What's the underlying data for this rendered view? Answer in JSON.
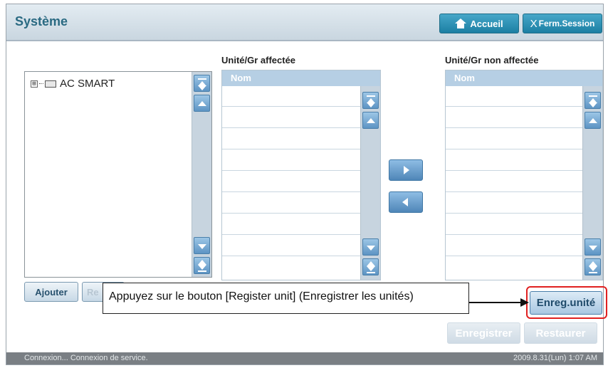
{
  "header": {
    "title": "Système",
    "home_label": "Accueil",
    "logout_x": "X",
    "logout_label": "Ferm.Session"
  },
  "tree": {
    "expander": "⊞",
    "root_label": "AC SMART"
  },
  "assigned": {
    "title": "Unité/Gr affectée",
    "column": "Nom"
  },
  "unassigned": {
    "title": "Unité/Gr non affectée",
    "column": "Nom"
  },
  "buttons": {
    "add": "Ajouter",
    "partial": "Re",
    "register_unit": "Enreg.unité",
    "save": "Enregistrer",
    "restore": "Restaurer"
  },
  "callout": {
    "text": "Appuyez sur le bouton [Register unit] (Enregistrer les unités)"
  },
  "status": {
    "message": "Connexion... Connexion de service.",
    "datetime": "2009.8.31(Lun)  1:07 AM"
  },
  "colors": {
    "title": "#2a6a82",
    "header_btn": "#1c7fa3",
    "highlight": "#e02020",
    "list_header": "#b6cfe4"
  }
}
